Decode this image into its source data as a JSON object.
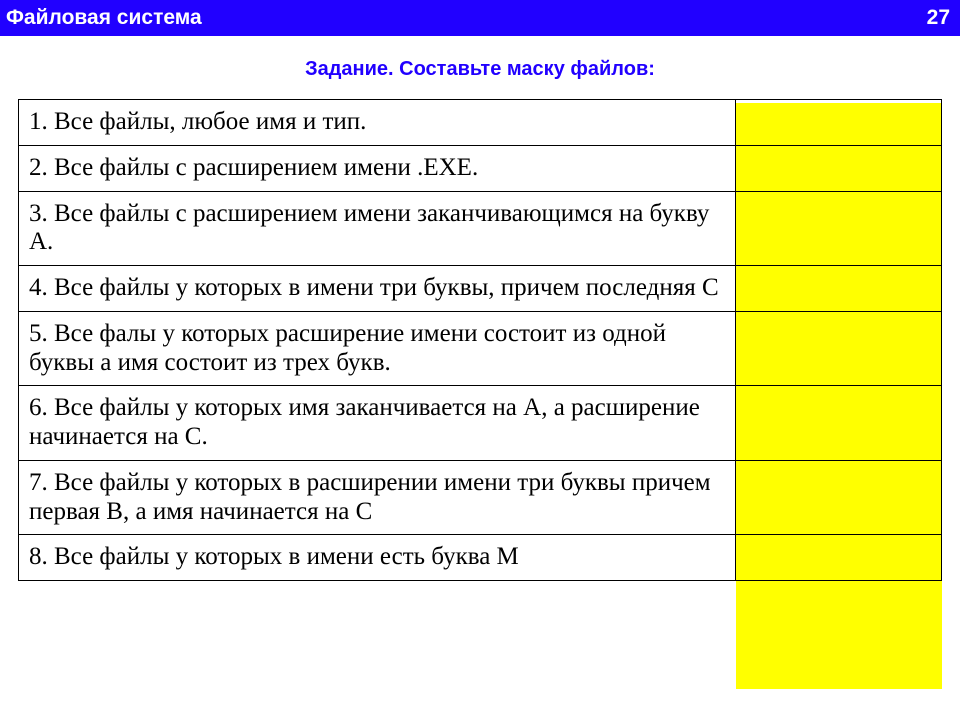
{
  "header": {
    "title": "Файловая система",
    "pageno": "27"
  },
  "subtitle": "Задание. Составьте маску файлов:",
  "rows": [
    {
      "q": "1. Все файлы, любое имя и тип.",
      "a": ""
    },
    {
      "q": "2. Все файлы с расширением имени .EXE.",
      "a": ""
    },
    {
      "q": "3. Все файлы  с расширением имени заканчивающимся  на букву A.",
      "a": ""
    },
    {
      "q": "4. Все файлы у которых в имени три буквы, причем последняя C",
      "a": ""
    },
    {
      "q": "5. Все фалы у которых расширение имени состоит из одной буквы а имя состоит из трех букв.",
      "a": ""
    },
    {
      "q": "6. Все файлы у которых имя заканчивается на A, а расширение начинается на C.",
      "a": ""
    },
    {
      "q": "7. Все файлы у которых в расширении имени три буквы причем первая B, а имя начинается на C",
      "a": ""
    },
    {
      "q": "8. Все файлы у которых в имени есть буква M",
      "a": ""
    }
  ]
}
